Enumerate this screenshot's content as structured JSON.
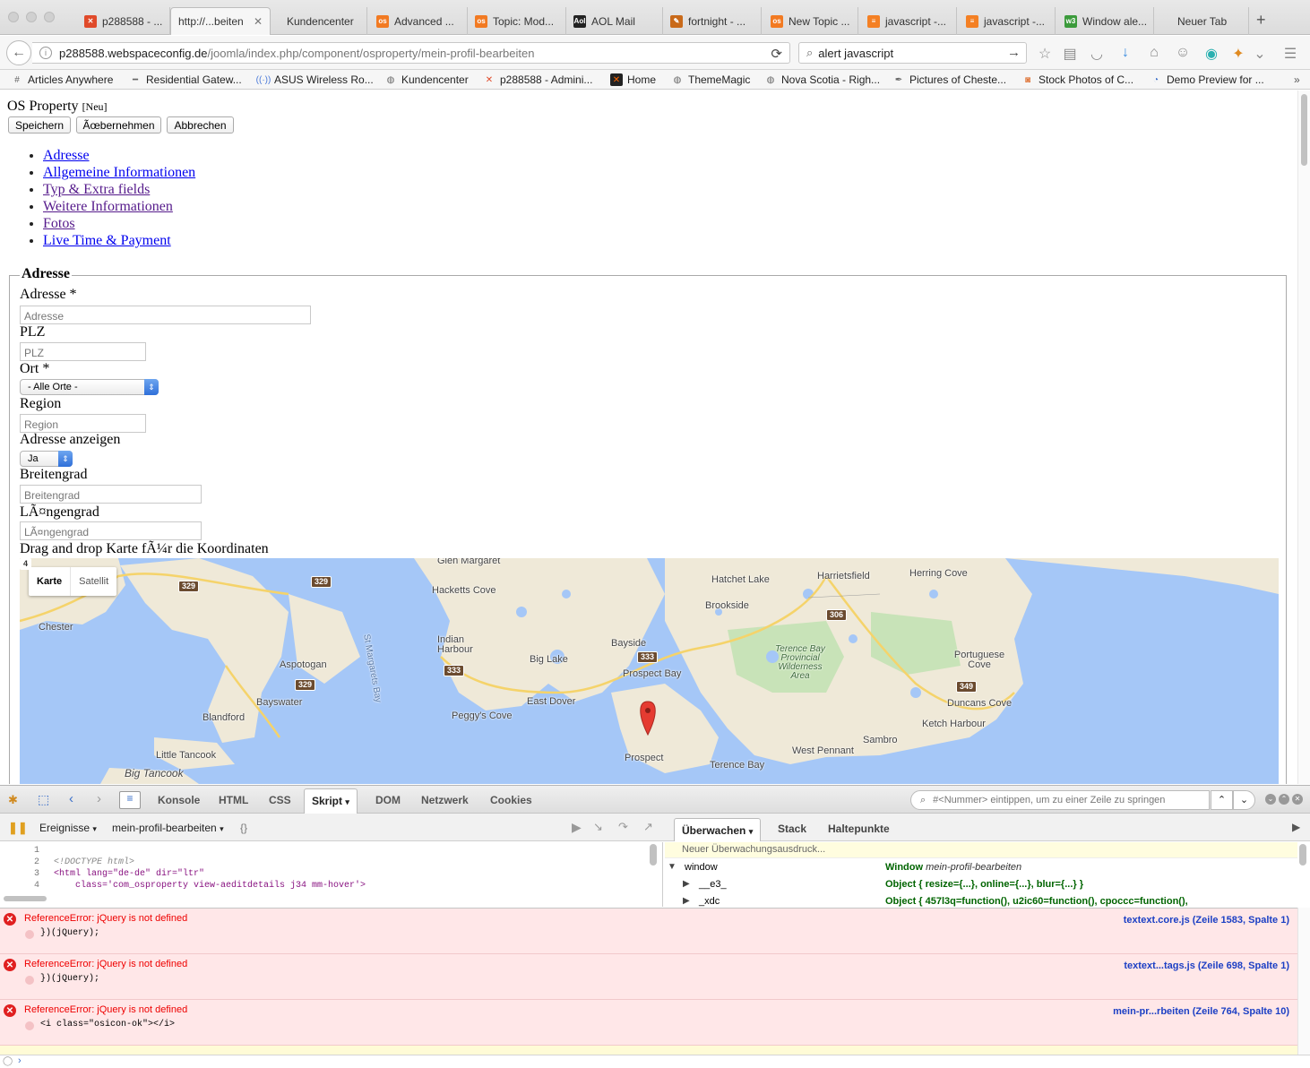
{
  "tabs": [
    {
      "label": "p288588 - ...",
      "color": "#e04a2a"
    },
    {
      "label": "http://...beiten",
      "color": ""
    },
    {
      "label": "Kundencenter",
      "color": ""
    },
    {
      "label": "Advanced ...",
      "color": "#f27a22"
    },
    {
      "label": "Topic: Mod...",
      "color": "#f27a22"
    },
    {
      "label": "AOL Mail",
      "color": "#222222"
    },
    {
      "label": "fortnight - ...",
      "color": "#c96a1a"
    },
    {
      "label": "New Topic ...",
      "color": "#f27a22"
    },
    {
      "label": "javascript -...",
      "color": "#f48024"
    },
    {
      "label": "javascript -...",
      "color": "#f48024"
    },
    {
      "label": "Window ale...",
      "color": "#3c9b3c"
    },
    {
      "label": "Neuer Tab",
      "color": ""
    }
  ],
  "nav": {
    "url_host": "p288588.webspaceconfig.de",
    "url_path": "/joomla/index.php/component/osproperty/mein-profil-bearbeiten",
    "search_value": "alert javascript"
  },
  "bookmarks": [
    "Articles Anywhere",
    "Residential Gatew...",
    "ASUS Wireless Ro...",
    "Kundencenter",
    "p288588 - Admini...",
    "Home",
    "ThemeMagic",
    "Nova Scotia - Righ...",
    "Pictures of Cheste...",
    "Stock Photos of C...",
    "Demo Preview for ..."
  ],
  "page": {
    "title": "OS Property",
    "title_badge": "[Neu]",
    "buttons": {
      "save": "Speichern",
      "apply": "Ãœbernehmen",
      "cancel": "Abbrechen"
    },
    "section_links": [
      "Adresse",
      "Allgemeine Informationen",
      "Typ & Extra fields",
      "Weitere Informationen",
      "Fotos",
      "Live Time & Payment"
    ],
    "legend": "Adresse",
    "form": {
      "address_label": "Adresse *",
      "address_placeholder": "Adresse",
      "zip_label": "PLZ",
      "zip_placeholder": "PLZ",
      "city_label": "Ort *",
      "city_value": "- Alle Orte -",
      "region_label": "Region",
      "region_placeholder": "Region",
      "show_address_label": "Adresse anzeigen",
      "show_address_value": "Ja",
      "lat_label": "Breitengrad",
      "lat_placeholder": "Breitengrad",
      "lng_label": "LÃ¤ngengrad",
      "lng_placeholder": "LÃ¤ngengrad",
      "map_hint": "Drag and drop Karte fÃ¼r die Koordinaten"
    },
    "map": {
      "type_map": "Karte",
      "type_satellite": "Satellit",
      "places": [
        "Glen Margaret",
        "Hacketts Cove",
        "Hatchet Lake",
        "Harrietsfield",
        "Herring Cove",
        "Brookside",
        "Chester",
        "Indian Harbour",
        "Bayside",
        "Big Lake",
        "Prospect Bay",
        "Aspotogan",
        "Bayswater",
        "Blandford",
        "East Dover",
        "Peggy's Cove",
        "Portuguese Cove",
        "Duncans Cove",
        "Ketch Harbour",
        "Sambro",
        "West Pennant",
        "Prospect",
        "Terence Bay",
        "Little Tancook",
        "Big Tancook"
      ],
      "park_label": "Terence Bay Provincial Wilderness Area",
      "water_label": "St Margarets Bay",
      "route_shields": [
        "329",
        "329",
        "329",
        "333",
        "333",
        "306",
        "349",
        "4"
      ]
    }
  },
  "firebug": {
    "tabs": [
      "Konsole",
      "HTML",
      "CSS",
      "Skript",
      "DOM",
      "Netzwerk",
      "Cookies"
    ],
    "active_tab": "Skript",
    "goto_placeholder": "#<Nummer> eintippen, um zu einer Zeile zu springen",
    "events_label": "Ereignisse",
    "file_label": "mein-profil-bearbeiten",
    "right_tabs": [
      "Überwachen",
      "Stack",
      "Haltepunkte"
    ],
    "watch_new": "Neuer Überwachungsausdruck...",
    "watch": [
      {
        "name": "window",
        "value": "Window",
        "detail": "mein-profil-bearbeiten"
      },
      {
        "name": "__e3_",
        "value": "Object { resize={...}, online={...}, blur={...} }",
        "detail": ""
      },
      {
        "name": "_xdc",
        "value": "Object { 457l3q=function(), u2ic60=function(), cpoccc=function(),",
        "detail": ""
      }
    ],
    "source_lines": [
      {
        "n": "1",
        "text": ""
      },
      {
        "n": "2",
        "text": "<!DOCTYPE html>"
      },
      {
        "n": "3",
        "text": "<html lang=\"de-de\" dir=\"ltr\""
      },
      {
        "n": "4",
        "text": "    class='com_osproperty view-aeditdetails j34 mm-hover'>"
      }
    ],
    "errors": [
      {
        "msg": "ReferenceError: jQuery is not defined",
        "src": "})(jQuery);",
        "loc": "textext.core.js (Zeile 1583, Spalte 1)"
      },
      {
        "msg": "ReferenceError: jQuery is not defined",
        "src": "})(jQuery);",
        "loc": "textext...tags.js (Zeile 698, Spalte 1)"
      },
      {
        "msg": "ReferenceError: jQuery is not defined",
        "src": "<i class=\"osicon-ok\"></i>",
        "loc": "mein-pr...rbeiten (Zeile 764, Spalte 10)"
      }
    ]
  }
}
